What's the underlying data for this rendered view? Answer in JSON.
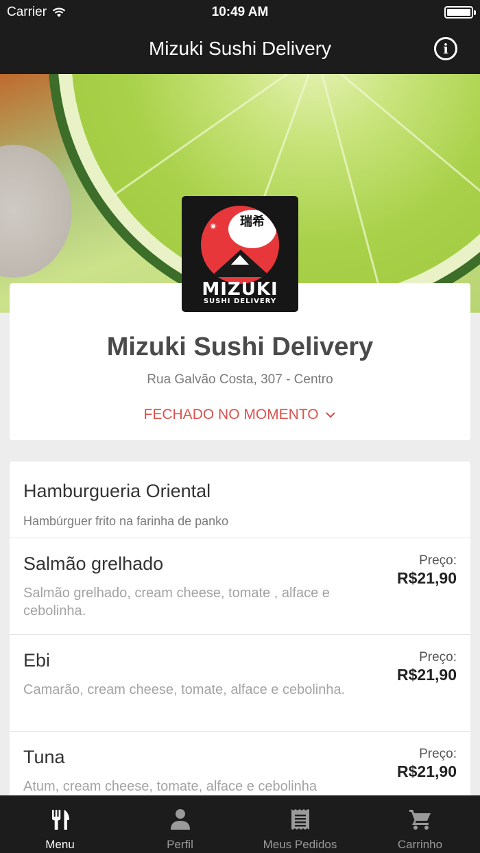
{
  "status_bar": {
    "carrier": "Carrier",
    "time": "10:49 AM"
  },
  "nav": {
    "title": "Mizuki Sushi Delivery"
  },
  "logo": {
    "kanji": "瑞希",
    "brand": "MIZUKI",
    "tagline": "SUSHI DELIVERY"
  },
  "restaurant": {
    "name": "Mizuki Sushi Delivery",
    "address": "Rua Galvão Costa, 307 - Centro",
    "status": "FECHADO NO MOMENTO"
  },
  "menu": {
    "category": {
      "title": "Hamburgueria Oriental",
      "description": "Hambúrguer frito na farinha de panko"
    },
    "items": [
      {
        "name": "Salmão grelhado",
        "description": "Salmão grelhado, cream cheese, tomate , alface e cebolinha.",
        "price_label": "Preço:",
        "price": "R$21,90"
      },
      {
        "name": "Ebi",
        "description": "Camarão, cream cheese, tomate, alface e cebolinha.",
        "price_label": "Preço:",
        "price": "R$21,90"
      },
      {
        "name": "Tuna",
        "description": "Atum, cream cheese, tomate, alface e cebolinha",
        "price_label": "Preço:",
        "price": "R$21,90"
      }
    ]
  },
  "tabs": [
    {
      "label": "Menu",
      "icon": "fork-knife-icon",
      "active": true
    },
    {
      "label": "Perfil",
      "icon": "person-icon",
      "active": false
    },
    {
      "label": "Meus Pedidos",
      "icon": "receipt-icon",
      "active": false
    },
    {
      "label": "Carrinho",
      "icon": "cart-icon",
      "active": false
    }
  ],
  "colors": {
    "bar": "#1c1c1c",
    "status_closed": "#d9534f",
    "background": "#ededed"
  }
}
